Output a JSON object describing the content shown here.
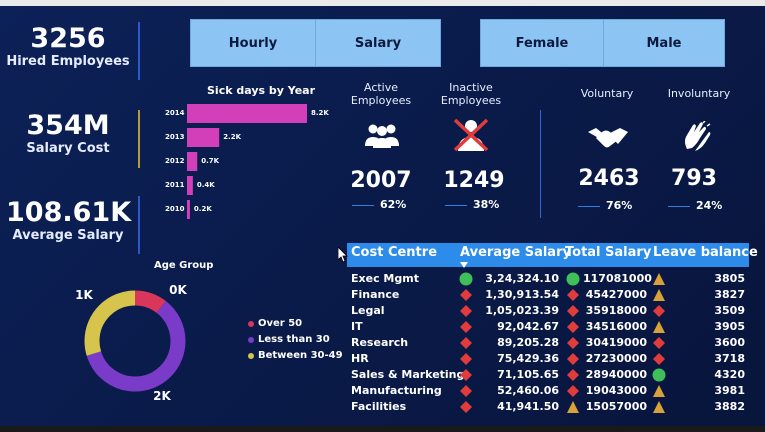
{
  "colors": {
    "background": "#0a1d4e",
    "bar": "#d33fb8",
    "slicer": "#8cc5f3",
    "table_header": "#2d8cea",
    "good": "#3fbf5a",
    "bad": "#e03c3c",
    "warn": "#d8a238",
    "over50": "#d8365b",
    "less30": "#7a3bc8",
    "between30_49": "#d6c44c"
  },
  "kpis": [
    {
      "value": "3256",
      "label": "Hired Employees"
    },
    {
      "value": "354M",
      "label": "Salary Cost"
    },
    {
      "value": "108.61K",
      "label": "Average Salary"
    }
  ],
  "slicers": {
    "type": [
      "Hourly",
      "Salary"
    ],
    "gender": [
      "Female",
      "Male"
    ]
  },
  "status": {
    "active": {
      "title": "Active Employees",
      "value": "2007",
      "pct": "62%",
      "icon": "people-group-icon"
    },
    "inactive": {
      "title": "Inactive Employees",
      "value": "1249",
      "pct": "38%",
      "icon": "crossed-person-icon"
    },
    "voluntary": {
      "title": "Voluntary",
      "value": "2463",
      "pct": "76%",
      "icon": "handshake-icon"
    },
    "involuntary": {
      "title": "Involuntary",
      "value": "793",
      "pct": "24%",
      "icon": "clapping-hands-icon"
    }
  },
  "table": {
    "headers": [
      "Cost Centre",
      "Average Salary",
      "Total Salary",
      "Leave balance"
    ],
    "rows": [
      {
        "cc": "Exec Mgmt",
        "avg": "3,24,324.10",
        "avg_kpi": "good",
        "total": "117081000",
        "total_kpi": "good",
        "leave": "3805",
        "leave_kpi": "warn"
      },
      {
        "cc": "Finance",
        "avg": "1,30,913.54",
        "avg_kpi": "bad",
        "total": "45427000",
        "total_kpi": "bad",
        "leave": "3827",
        "leave_kpi": "warn"
      },
      {
        "cc": "Legal",
        "avg": "1,05,023.39",
        "avg_kpi": "bad",
        "total": "35918000",
        "total_kpi": "bad",
        "leave": "3509",
        "leave_kpi": "bad"
      },
      {
        "cc": "IT",
        "avg": "92,042.67",
        "avg_kpi": "bad",
        "total": "34516000",
        "total_kpi": "bad",
        "leave": "3905",
        "leave_kpi": "warn"
      },
      {
        "cc": "Research",
        "avg": "89,205.28",
        "avg_kpi": "bad",
        "total": "30419000",
        "total_kpi": "bad",
        "leave": "3600",
        "leave_kpi": "bad"
      },
      {
        "cc": "HR",
        "avg": "75,429.36",
        "avg_kpi": "bad",
        "total": "27230000",
        "total_kpi": "bad",
        "leave": "3718",
        "leave_kpi": "bad"
      },
      {
        "cc": "Sales & Marketing",
        "avg": "71,105.65",
        "avg_kpi": "bad",
        "total": "28940000",
        "total_kpi": "bad",
        "leave": "4320",
        "leave_kpi": "good"
      },
      {
        "cc": "Manufacturing",
        "avg": "52,460.06",
        "avg_kpi": "bad",
        "total": "19043000",
        "total_kpi": "bad",
        "leave": "3981",
        "leave_kpi": "warn"
      },
      {
        "cc": "Facilities",
        "avg": "41,941.50",
        "avg_kpi": "bad",
        "total": "15057000",
        "total_kpi": "warn",
        "leave": "3882",
        "leave_kpi": "warn"
      }
    ]
  },
  "chart_data": [
    {
      "type": "bar",
      "title": "Sick days by Year",
      "categories": [
        "2014",
        "2013",
        "2012",
        "2011",
        "2010"
      ],
      "values": [
        8.2,
        2.2,
        0.7,
        0.4,
        0.2
      ],
      "value_labels": [
        "8.2K",
        "2.2K",
        "0.7K",
        "0.4K",
        "0.2K"
      ],
      "orientation": "horizontal",
      "xlim": [
        0,
        8.2
      ]
    },
    {
      "type": "pie",
      "title": "Age Group",
      "categories": [
        "Over 50",
        "Less than 30",
        "Between 30-49"
      ],
      "values": [
        0.35,
        2.0,
        1.0
      ],
      "value_labels": [
        "0K",
        "2K",
        "1K"
      ],
      "donut": true,
      "legend_position": "right"
    }
  ]
}
